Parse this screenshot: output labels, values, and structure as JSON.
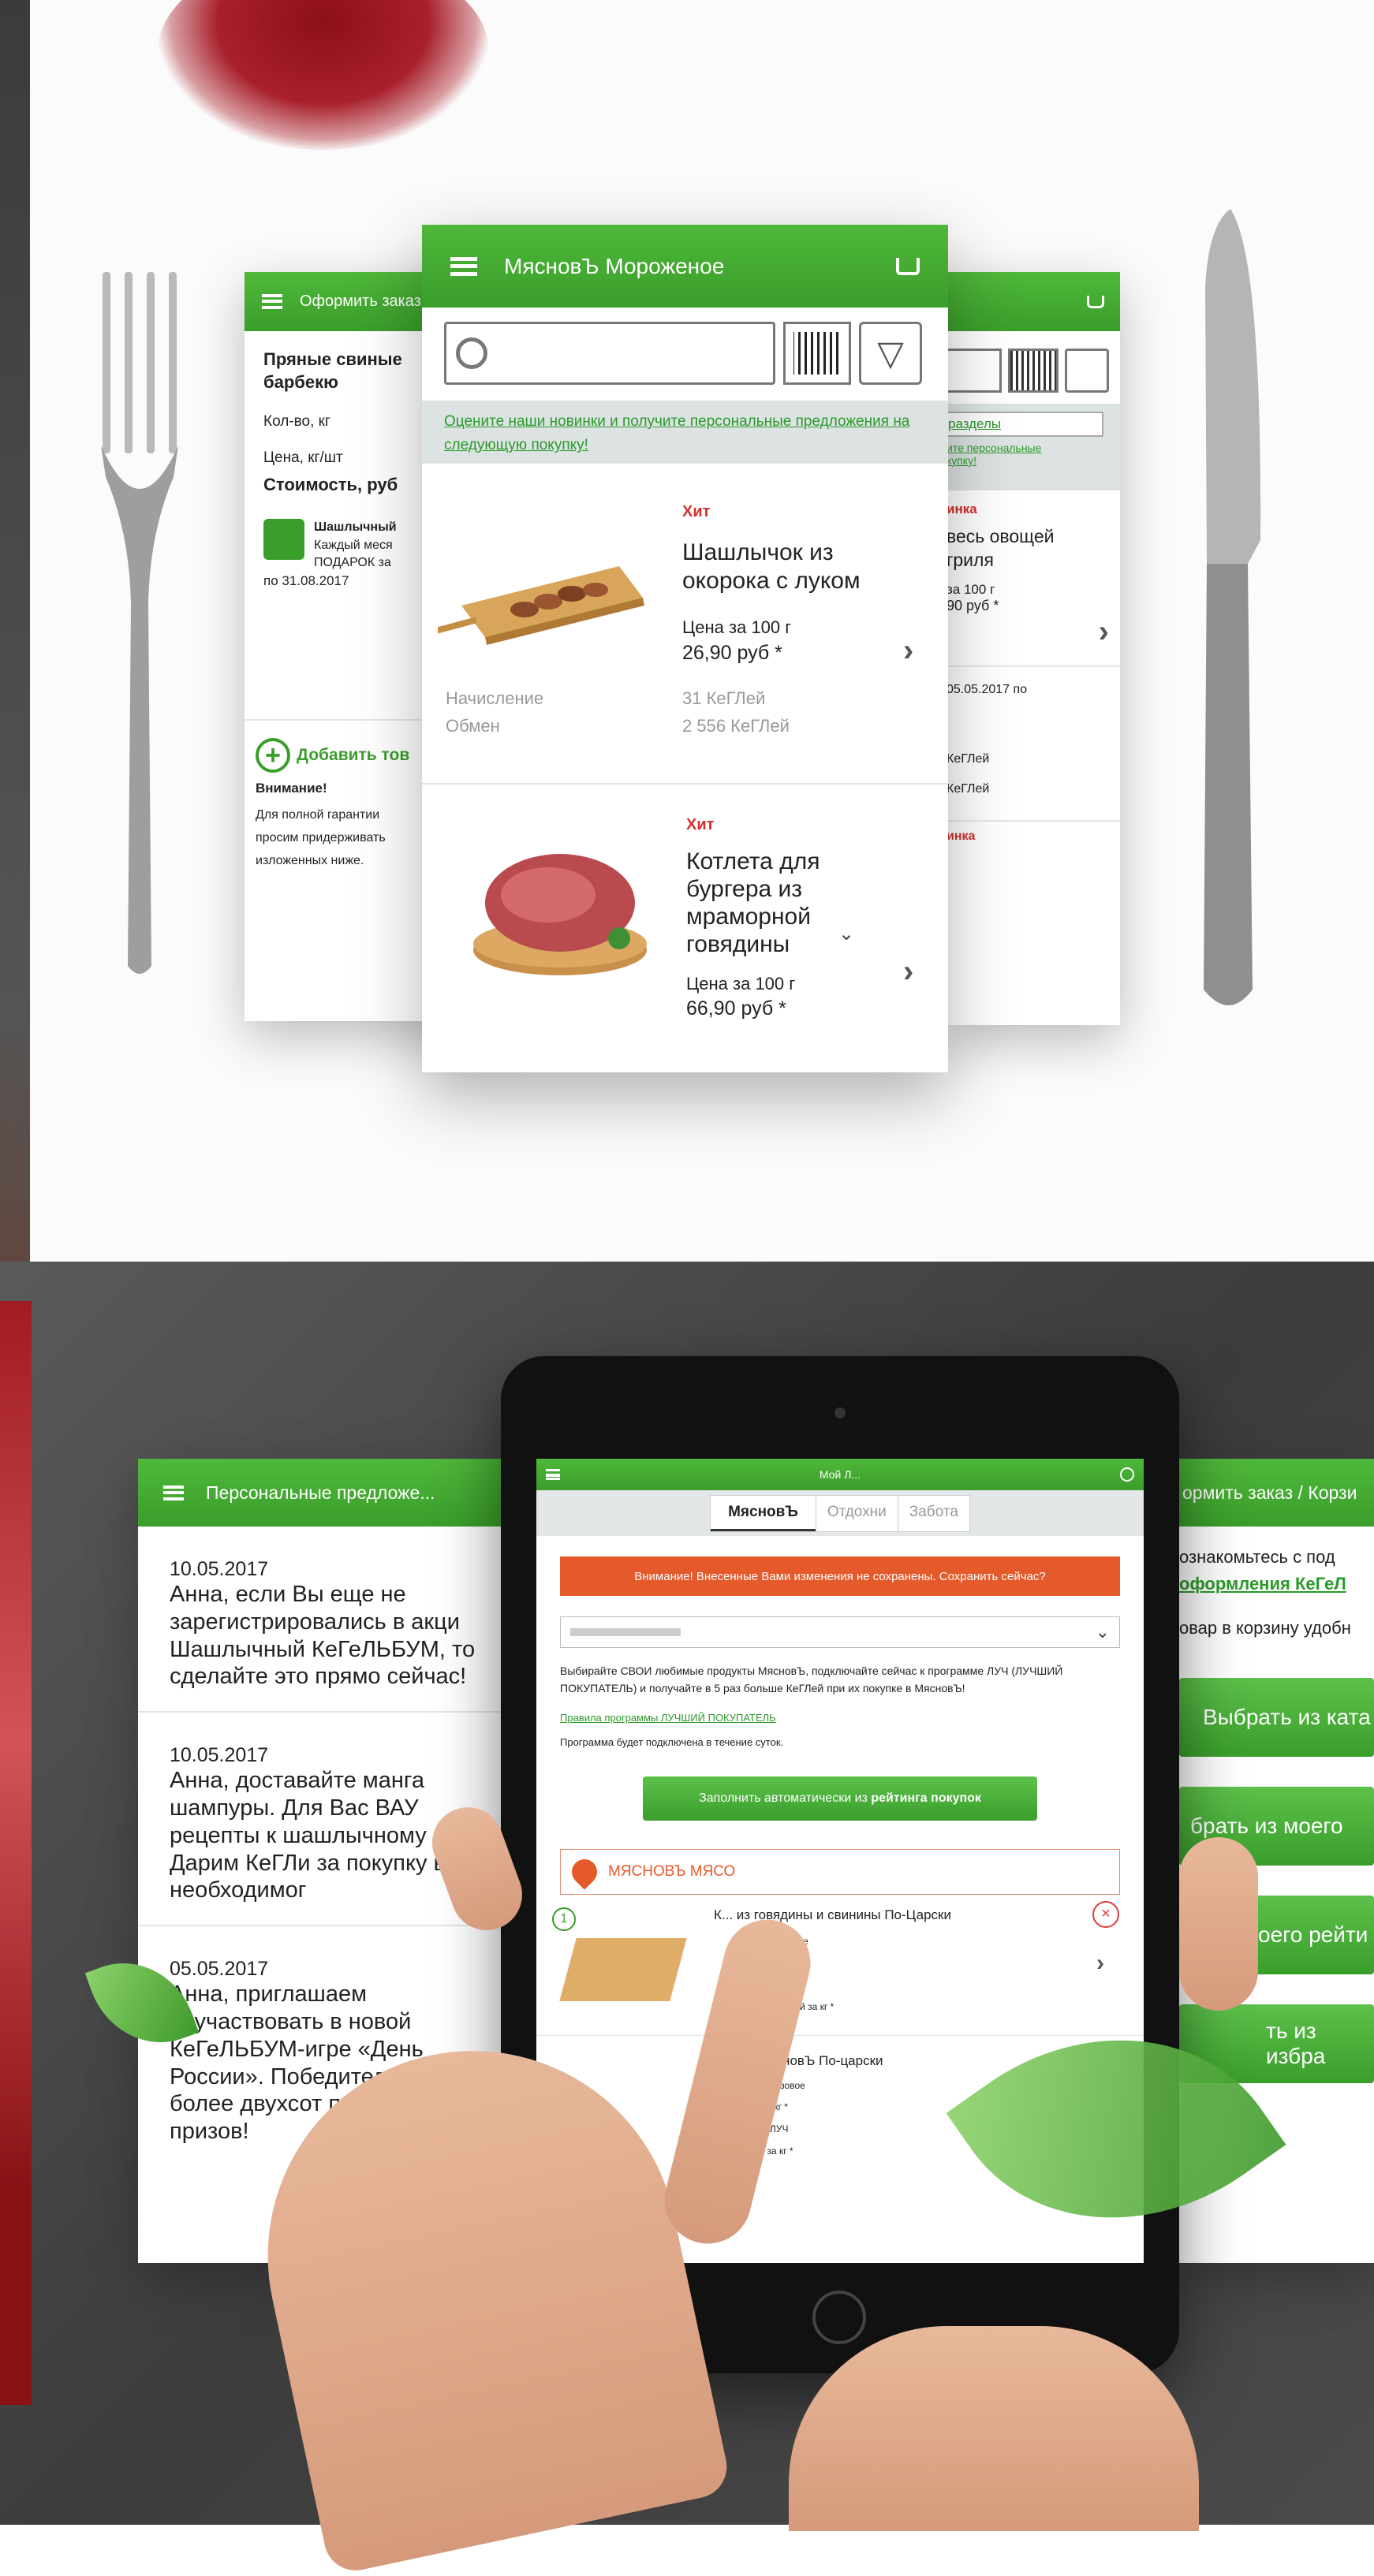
{
  "center_phone": {
    "title": "МясновЪ Мороженое",
    "promo_text": "Оцените наши новинки и получите персональные предложения на следующую покупку!",
    "products": [
      {
        "badge": "Хит",
        "name": "Шашлычок из окорока с луком",
        "price_label": "Цена за 100 г",
        "price": "26,90 руб *",
        "accrual_label": "Начисление",
        "accrual_value": "31 КеГЛей",
        "exchange_label": "Обмен",
        "exchange_value": "2 556 КеГЛей"
      },
      {
        "badge": "Хит",
        "name": "Котлета для бургера из мраморной говядины",
        "price_label": "Цена за 100 г",
        "price": "66,90 руб *"
      }
    ]
  },
  "left_phone": {
    "title": "Оформить заказ",
    "product_name": "Пряные свиные барбекю",
    "qty_label": "Кол-во, кг",
    "price_label": "Цена, кг/шт",
    "cost_label": "Стоимость, руб",
    "promo_title": "Шашлычный",
    "promo_line1": "Каждый меся",
    "promo_line2": "ПОДАРОК за",
    "promo_date": "по 31.08.2017",
    "add_label": "Добавить тов",
    "attention": "Внимание!",
    "note_line1": "Для полной гарантии",
    "note_line2": "просим придерживать",
    "note_line3": "изложенных ниже."
  },
  "right_phone": {
    "section_link": "разделы",
    "promo_small1": "ите персональные",
    "promo_small2": "купку!",
    "badge": "инка",
    "name": "весь овощей гриля",
    "price_label": "за 100 г",
    "price": "90 руб *",
    "date": "05.05.2017 по",
    "line1": "КеГЛей",
    "line2": "КеГЛей",
    "badge2": "инка"
  },
  "left_card": {
    "title": "Персональные предложе...",
    "messages": [
      {
        "date": "10.05.2017",
        "text": "Анна, если Вы еще не зарегистрировались в акци Шашлычный КеГеЛЬБУМ, то сделайте это прямо сейчас!"
      },
      {
        "date": "10.05.2017",
        "text": "Анна, доставайте манга шампуры. Для Вас ВАУ рецепты к шашлычному сезону. Дарим КеГЛи за покупку всего необходимог"
      },
      {
        "date": "05.05.2017",
        "text": "Анна, приглашаем поучаствовать в новой КеГеЛЬБУМ-игре «День России». Победителей ждут более двухсот потрясающи призов!"
      }
    ]
  },
  "right_card": {
    "title": "ормить заказ / Корзи",
    "line1": "ознакомьтесь с под",
    "line2": "оформления КеГеЛ",
    "line3": "овар в корзину удобн",
    "buttons": [
      "Выбрать из ката",
      "брать из моего",
      "оего рейти",
      "ть из избра"
    ]
  },
  "tablet": {
    "header_title": "Мой Л...",
    "tabs": [
      "МясновЪ",
      "Отдохни",
      "Забота"
    ],
    "warning": "Внимание! Внесенные Вами изменения не сохранены. Сохранить сейчас?",
    "intro": "Выбирайте СВОИ любимые продукты МясновЪ, подключайте сейчас к программе ЛУЧ (ЛУЧШИЙ ПОКУПАТЕЛЬ) и получайте в 5 раз больше КеГЛей при их покупке в МясновЪ!",
    "rules_link": "Правила программы ЛУЧШИЙ ПОКУПАТЕЛЬ",
    "connect_note": "Программа будет подключена в течение суток.",
    "autofill_prefix": "Заполнить автоматически из ",
    "autofill_bold": "рейтинга покупок",
    "section_title": "МЯСНОВЪ МЯСО",
    "item1_name": "К... из говядины и свинины По-Царски",
    "item1_lines": [
      "базовое",
      "за кг *",
      "ие ЛУЧ",
      "КеГЛей за кг *"
    ],
    "item1_number": "1",
    "item2_name": "Фарш МясновЪ По-царски",
    "item2_lines": [
      "Начисление базовое",
      "40 КеГЛей за кг *",
      "Начисление ЛУЧ",
      "200 КеГЛей за кг *"
    ]
  }
}
